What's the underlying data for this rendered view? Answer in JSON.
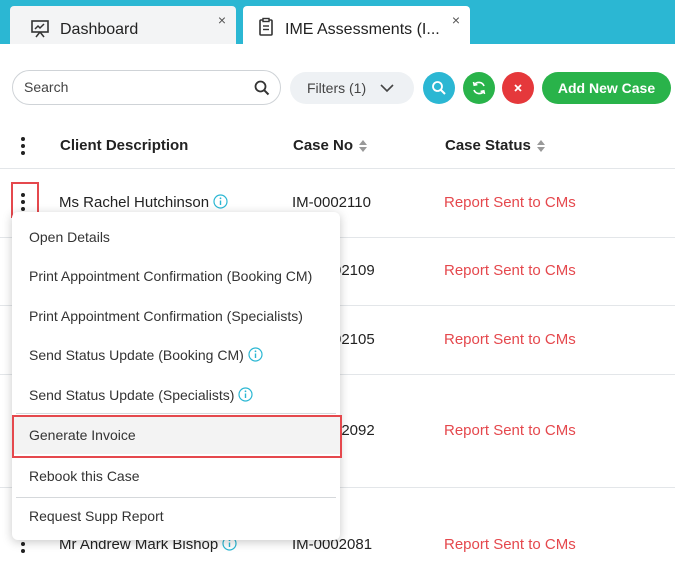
{
  "tabs": [
    {
      "label": "Dashboard",
      "icon": "presentation-icon",
      "close": "×"
    },
    {
      "label": "IME Assessments (I...",
      "icon": "clipboard-icon",
      "close": "×"
    }
  ],
  "toolbar": {
    "search_placeholder": "Search",
    "filters_label": "Filters (1)",
    "add_label": "Add New Case"
  },
  "table": {
    "headers": {
      "client": "Client Description",
      "case_no": "Case No",
      "status": "Case Status"
    },
    "rows": [
      {
        "client": "Ms Rachel Hutchinson",
        "case_no": "IM-0002110",
        "status": "Report Sent to CMs"
      },
      {
        "client": "",
        "case_no": "02109",
        "status": "Report Sent to CMs"
      },
      {
        "client": "",
        "case_no": "02105",
        "status": "Report Sent to CMs"
      },
      {
        "client": "",
        "case_no": "02092",
        "status": "Report Sent to CMs"
      },
      {
        "client": "Mr Andrew Mark Bishop",
        "case_no": "IM-0002081",
        "status": "Report Sent to CMs"
      }
    ]
  },
  "menu": {
    "items": [
      "Open Details",
      "Print Appointment Confirmation (Booking CM)",
      "Print Appointment Confirmation (Specialists)",
      "Send Status Update (Booking CM)",
      "Send Status Update (Specialists)",
      "Generate Invoice",
      "Rebook this Case",
      "Request Supp Report"
    ]
  },
  "colors": {
    "accent": "#2bb7d3",
    "success": "#29b34a",
    "danger": "#e5383b",
    "status": "#e5484d"
  }
}
